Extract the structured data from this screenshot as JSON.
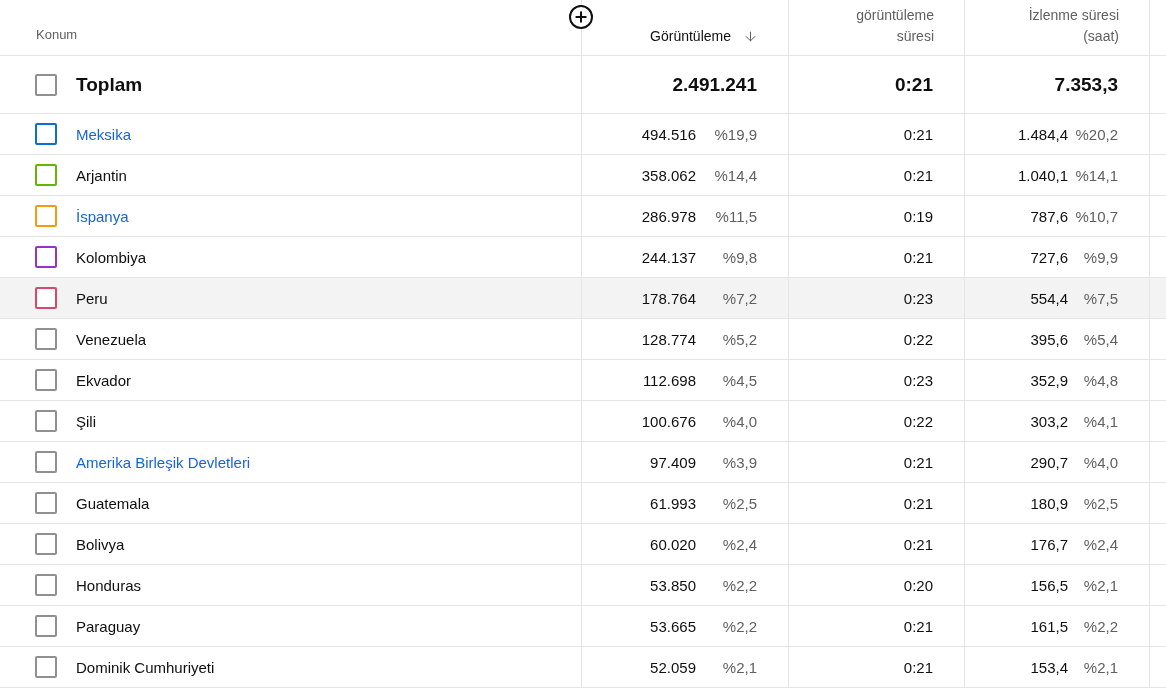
{
  "table": {
    "columns": [
      {
        "label": "Konum",
        "sorted": false
      },
      {
        "label": "Görüntüleme",
        "sorted": true
      },
      {
        "label": "görüntüleme süresi",
        "sorted": false
      },
      {
        "label": "İzlenme süresi (saat)",
        "sorted": false
      }
    ],
    "total": {
      "label": "Toplam",
      "checked": false,
      "views": "2.491.241",
      "avg_duration": "0:21",
      "watch_time": "7.353,3"
    },
    "rows": [
      {
        "name": "Meksika",
        "linked": true,
        "checked": false,
        "color": "#0b6fd4",
        "hovered": false,
        "views": "494.516",
        "views_share": "%19,9",
        "avg_duration": "0:21",
        "watch_time": "1.484,4",
        "watch_time_share": "%20,2"
      },
      {
        "name": "Arjantin",
        "linked": false,
        "checked": false,
        "color": "#67b500",
        "hovered": false,
        "views": "358.062",
        "views_share": "%14,4",
        "avg_duration": "0:21",
        "watch_time": "1.040,1",
        "watch_time_share": "%14,1"
      },
      {
        "name": "İspanya",
        "linked": true,
        "checked": false,
        "color": "#f29c11",
        "hovered": false,
        "views": "286.978",
        "views_share": "%11,5",
        "avg_duration": "0:19",
        "watch_time": "787,6",
        "watch_time_share": "%10,7"
      },
      {
        "name": "Kolombiya",
        "linked": false,
        "checked": false,
        "color": "#9334c7",
        "hovered": false,
        "views": "244.137",
        "views_share": "%9,8",
        "avg_duration": "0:21",
        "watch_time": "727,6",
        "watch_time_share": "%9,9"
      },
      {
        "name": "Peru",
        "linked": false,
        "checked": false,
        "color": "#d9486b",
        "hovered": true,
        "views": "178.764",
        "views_share": "%7,2",
        "avg_duration": "0:23",
        "watch_time": "554,4",
        "watch_time_share": "%7,5"
      },
      {
        "name": "Venezuela",
        "linked": false,
        "checked": false,
        "color": "#909090",
        "hovered": false,
        "views": "128.774",
        "views_share": "%5,2",
        "avg_duration": "0:22",
        "watch_time": "395,6",
        "watch_time_share": "%5,4"
      },
      {
        "name": "Ekvador",
        "linked": false,
        "checked": false,
        "color": "#909090",
        "hovered": false,
        "views": "112.698",
        "views_share": "%4,5",
        "avg_duration": "0:23",
        "watch_time": "352,9",
        "watch_time_share": "%4,8"
      },
      {
        "name": "Şili",
        "linked": false,
        "checked": false,
        "color": "#909090",
        "hovered": false,
        "views": "100.676",
        "views_share": "%4,0",
        "avg_duration": "0:22",
        "watch_time": "303,2",
        "watch_time_share": "%4,1"
      },
      {
        "name": "Amerika Birleşik Devletleri",
        "linked": true,
        "checked": false,
        "color": "#909090",
        "hovered": false,
        "views": "97.409",
        "views_share": "%3,9",
        "avg_duration": "0:21",
        "watch_time": "290,7",
        "watch_time_share": "%4,0"
      },
      {
        "name": "Guatemala",
        "linked": false,
        "checked": false,
        "color": "#909090",
        "hovered": false,
        "views": "61.993",
        "views_share": "%2,5",
        "avg_duration": "0:21",
        "watch_time": "180,9",
        "watch_time_share": "%2,5"
      },
      {
        "name": "Bolivya",
        "linked": false,
        "checked": false,
        "color": "#909090",
        "hovered": false,
        "views": "60.020",
        "views_share": "%2,4",
        "avg_duration": "0:21",
        "watch_time": "176,7",
        "watch_time_share": "%2,4"
      },
      {
        "name": "Honduras",
        "linked": false,
        "checked": false,
        "color": "#909090",
        "hovered": false,
        "views": "53.850",
        "views_share": "%2,2",
        "avg_duration": "0:20",
        "watch_time": "156,5",
        "watch_time_share": "%2,1"
      },
      {
        "name": "Paraguay",
        "linked": false,
        "checked": false,
        "color": "#909090",
        "hovered": false,
        "views": "53.665",
        "views_share": "%2,2",
        "avg_duration": "0:21",
        "watch_time": "161,5",
        "watch_time_share": "%2,2"
      },
      {
        "name": "Dominik Cumhuriyeti",
        "linked": false,
        "checked": false,
        "color": "#909090",
        "hovered": false,
        "views": "52.059",
        "views_share": "%2,1",
        "avg_duration": "0:21",
        "watch_time": "153,4",
        "watch_time_share": "%2,1"
      }
    ]
  }
}
